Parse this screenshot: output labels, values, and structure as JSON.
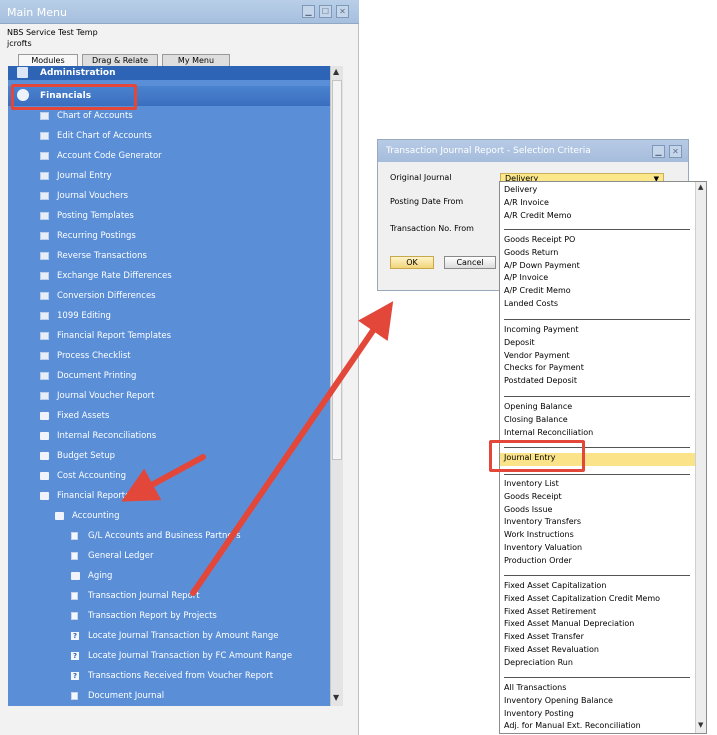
{
  "main_menu": {
    "title": "Main Menu",
    "company": "NBS Service Test Temp",
    "user": "jcrofts",
    "tabs": [
      "Modules",
      "Drag & Relate",
      "My Menu"
    ],
    "headers": {
      "administration": "Administration",
      "financials": "Financials"
    },
    "items": [
      {
        "label": "Chart of Accounts",
        "icon": "document-icon"
      },
      {
        "label": "Edit Chart of Accounts",
        "icon": "document-icon"
      },
      {
        "label": "Account Code Generator",
        "icon": "document-icon"
      },
      {
        "label": "Journal Entry",
        "icon": "document-icon"
      },
      {
        "label": "Journal Vouchers",
        "icon": "document-icon"
      },
      {
        "label": "Posting Templates",
        "icon": "document-icon"
      },
      {
        "label": "Recurring Postings",
        "icon": "document-icon"
      },
      {
        "label": "Reverse Transactions",
        "icon": "document-icon"
      },
      {
        "label": "Exchange Rate Differences",
        "icon": "document-icon"
      },
      {
        "label": "Conversion Differences",
        "icon": "document-icon"
      },
      {
        "label": "1099 Editing",
        "icon": "document-icon"
      },
      {
        "label": "Financial Report Templates",
        "icon": "document-icon"
      },
      {
        "label": "Process Checklist",
        "icon": "document-icon"
      },
      {
        "label": "Document Printing",
        "icon": "document-icon"
      },
      {
        "label": "Journal Voucher Report",
        "icon": "document-icon"
      },
      {
        "label": "Fixed Assets",
        "icon": "folder-icon"
      },
      {
        "label": "Internal Reconciliations",
        "icon": "folder-icon"
      },
      {
        "label": "Budget Setup",
        "icon": "folder-icon"
      },
      {
        "label": "Cost Accounting",
        "icon": "folder-icon"
      },
      {
        "label": "Financial Reports",
        "icon": "folder-open-icon"
      },
      {
        "label": "Accounting",
        "icon": "folder-open-icon"
      },
      {
        "label": "G/L Accounts and Business Partners",
        "icon": "report-icon"
      },
      {
        "label": "General Ledger",
        "icon": "report-icon"
      },
      {
        "label": "Aging",
        "icon": "folder-icon"
      },
      {
        "label": "Transaction Journal Report",
        "icon": "report-icon"
      },
      {
        "label": "Transaction Report by Projects",
        "icon": "report-icon"
      },
      {
        "label": "Locate Journal Transaction by Amount Range",
        "icon": "query-icon"
      },
      {
        "label": "Locate Journal Transaction by FC Amount Range",
        "icon": "query-icon"
      },
      {
        "label": "Transactions Received from Voucher Report",
        "icon": "query-icon"
      },
      {
        "label": "Document Journal",
        "icon": "report-icon"
      }
    ]
  },
  "dialog": {
    "title": "Transaction Journal Report - Selection Criteria",
    "labels": {
      "original_journal": "Original Journal",
      "posting_date_from": "Posting Date From",
      "transaction_no_from": "Transaction No. From"
    },
    "selected_journal": "Delivery",
    "ok_label": "OK",
    "cancel_label": "Cancel"
  },
  "dropdown": {
    "options": [
      "Delivery",
      "A/R Invoice",
      "A/R Credit Memo",
      "Goods Receipt PO",
      "Goods Return",
      "A/P Down Payment",
      "A/P Invoice",
      "A/P Credit Memo",
      "Landed Costs",
      "Incoming Payment",
      "Deposit",
      "Vendor Payment",
      "Checks for Payment",
      "Postdated Deposit",
      "Opening Balance",
      "Closing Balance",
      "Internal Reconciliation",
      "Journal Entry",
      "Inventory List",
      "Goods Receipt",
      "Goods Issue",
      "Inventory Transfers",
      "Work Instructions",
      "Inventory Valuation",
      "Production Order",
      "Fixed Asset Capitalization",
      "Fixed Asset Capitalization Credit Memo",
      "Fixed Asset Retirement",
      "Fixed Asset Manual Depreciation",
      "Fixed Asset Transfer",
      "Fixed Asset Revaluation",
      "Depreciation Run",
      "All Transactions",
      "Inventory Opening Balance",
      "Inventory Posting",
      "Adj. for Manual Ext. Reconciliation"
    ],
    "highlighted": "Journal Entry"
  },
  "colors": {
    "menu_panel": "#5a8fd8",
    "highlight_box": "#e2473a",
    "selected_option": "#fbe38a"
  }
}
